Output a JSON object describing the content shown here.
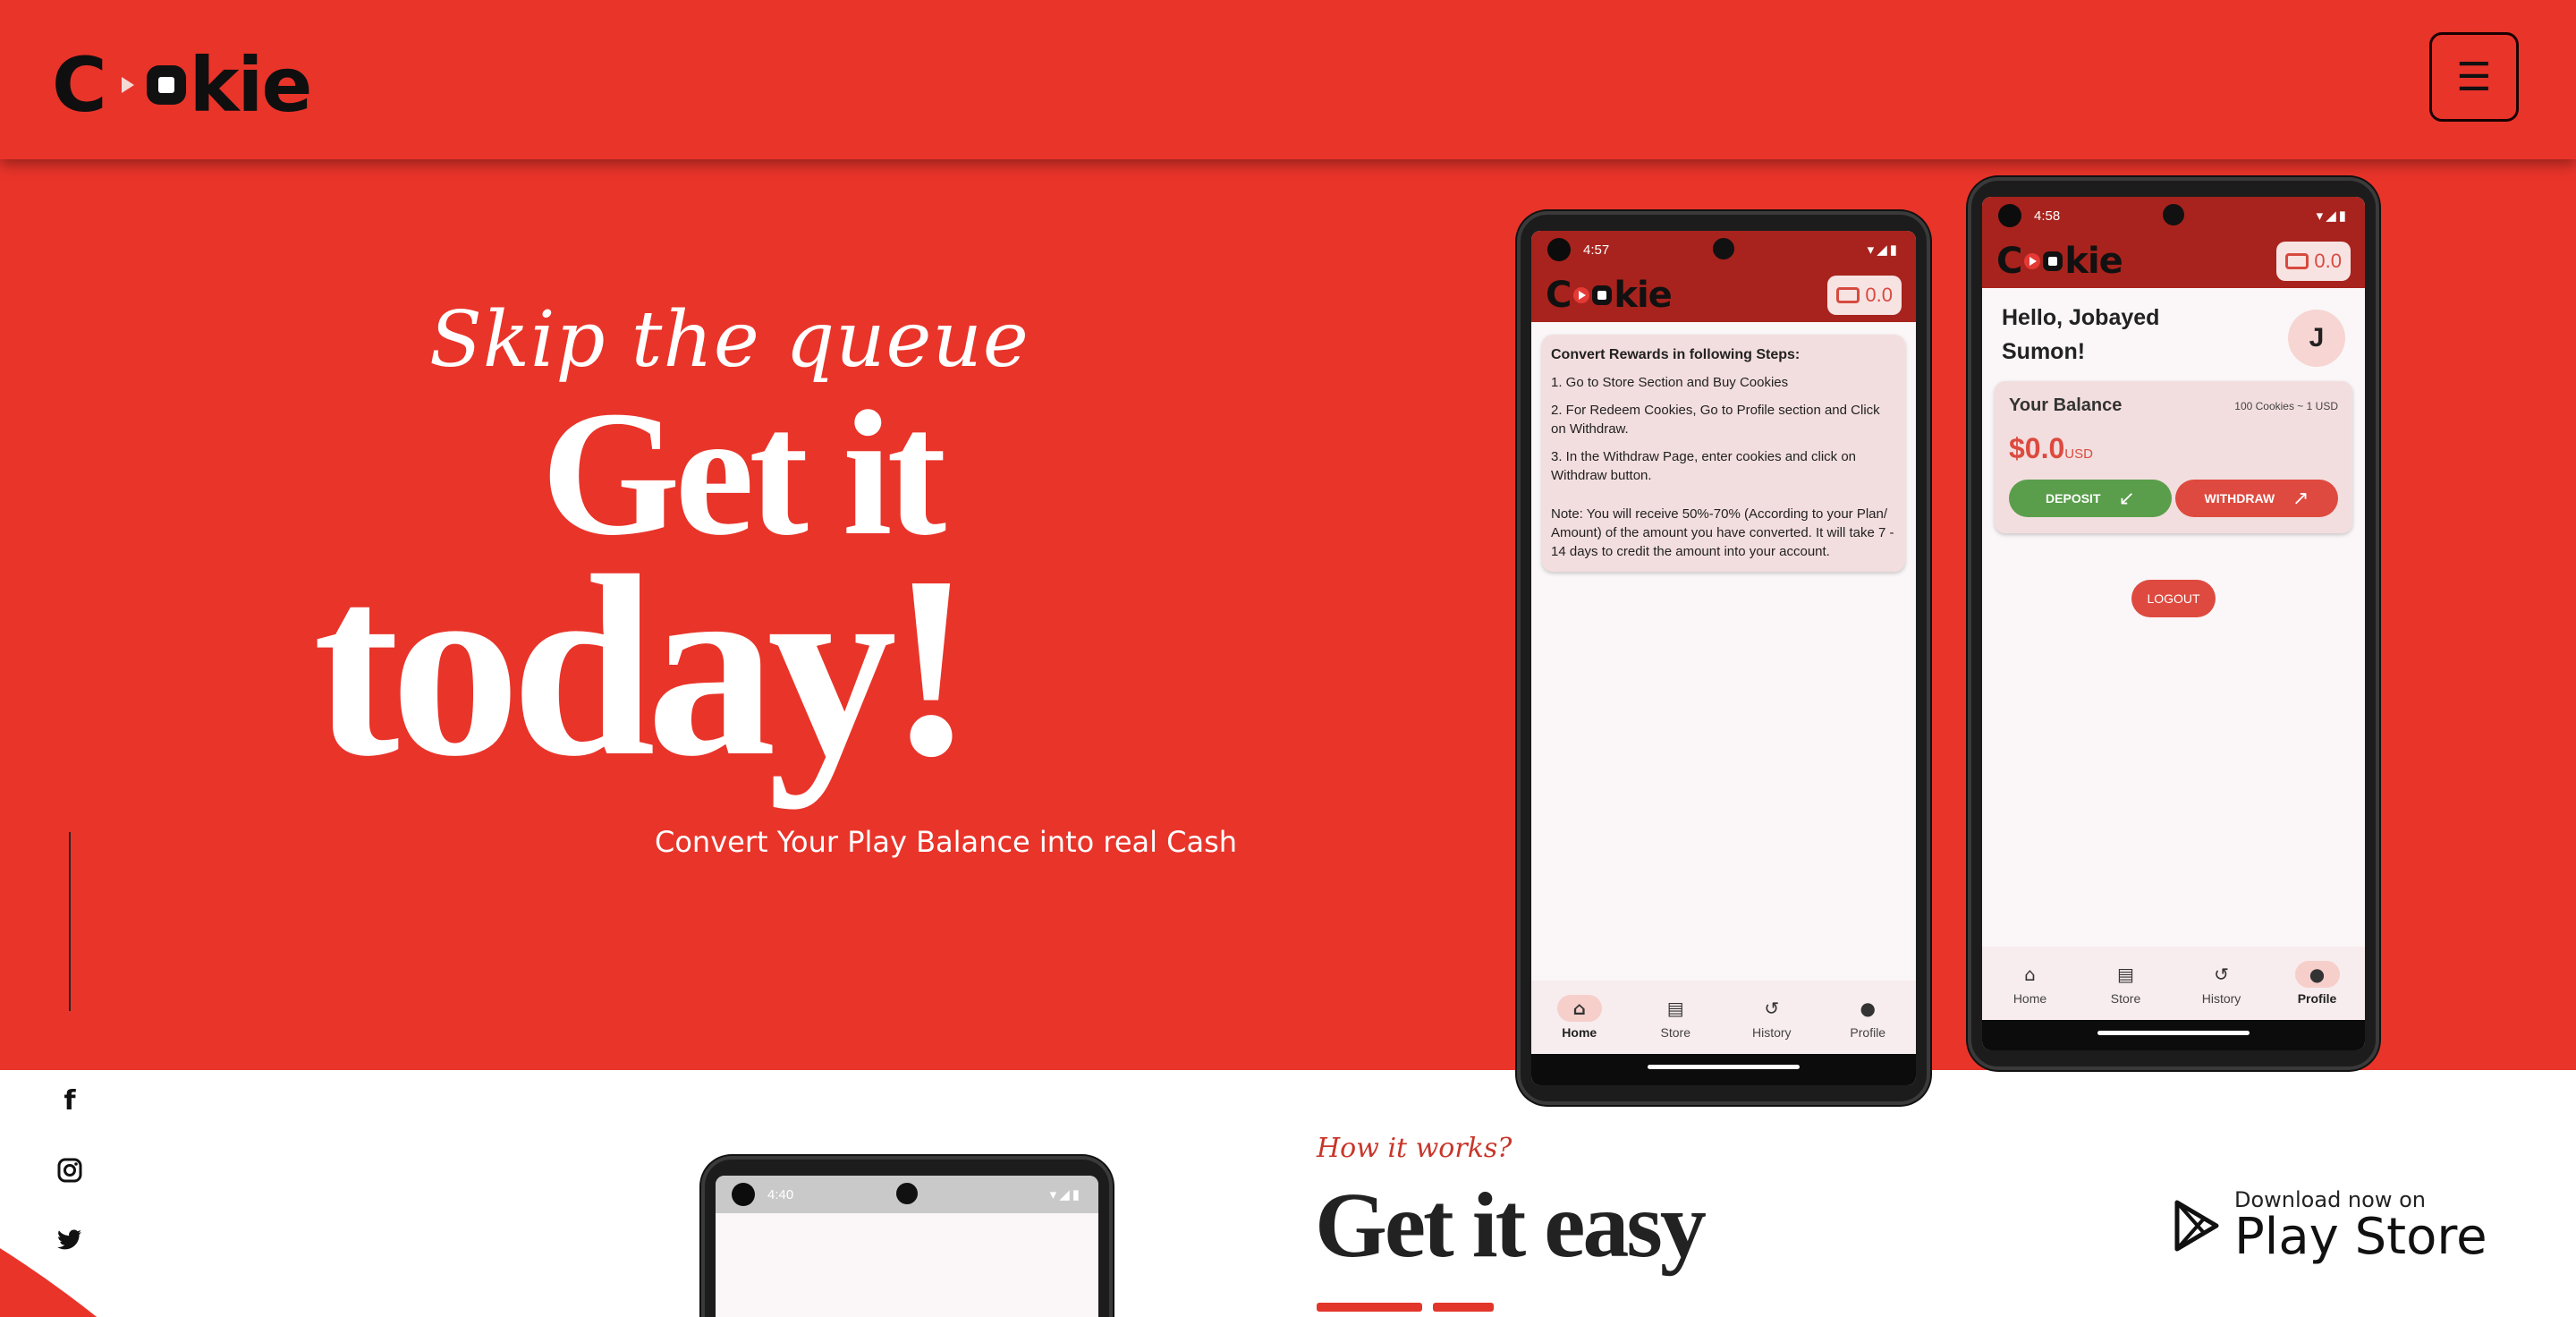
{
  "header": {
    "logo_text_start": "C",
    "logo_text_end": "kie",
    "menu_icon": "☰"
  },
  "hero": {
    "kicker": "Skip the queue",
    "headline_1": "Get it",
    "headline_2": "today!",
    "tagline": "Convert Your Play Balance into real Cash"
  },
  "social": {
    "facebook": "f",
    "instagram": "◎",
    "twitter": "🐦"
  },
  "phone_home": {
    "time": "4:57",
    "status_icons": "▾◢▮",
    "wallet_amount": "0.0",
    "steps_title": "Convert Rewards in following Steps:",
    "steps": [
      "1. Go to Store Section and Buy Cookies",
      "2. For Redeem Cookies, Go to Profile section and Click on Withdraw.",
      "3. In the Withdraw Page, enter cookies and click on Withdraw button."
    ],
    "note": "Note: You will receive 50%-70% (According to your Plan/ Amount) of the amount you have converted. It will take 7 - 14 days to credit the amount into your account.",
    "nav": [
      "Home",
      "Store",
      "History",
      "Profile"
    ],
    "active_tab": "Home"
  },
  "phone_profile": {
    "time": "4:58",
    "status_icons": "▾◢▮",
    "wallet_amount": "0.0",
    "greeting": "Hello, Jobayed Sumon!",
    "avatar_letter": "J",
    "balance_title": "Your Balance",
    "rate": "100 Cookies ~ 1 USD",
    "amount": "$0.0",
    "currency": "USD",
    "deposit_label": "DEPOSIT",
    "withdraw_label": "WITHDRAW",
    "logout_label": "LOGOUT",
    "nav": [
      "Home",
      "Store",
      "History",
      "Profile"
    ],
    "active_tab": "Profile"
  },
  "phone_third": {
    "time": "4:40",
    "status_icons": "▾◢▮"
  },
  "how": {
    "kicker": "How it works?",
    "title": "Get it easy"
  },
  "download": {
    "line1": "Download now on",
    "line2": "Play Store"
  },
  "colors": {
    "brand_red": "#e9342a",
    "appbar_red": "#a8231d",
    "deposit_green": "#5a9e4c"
  }
}
